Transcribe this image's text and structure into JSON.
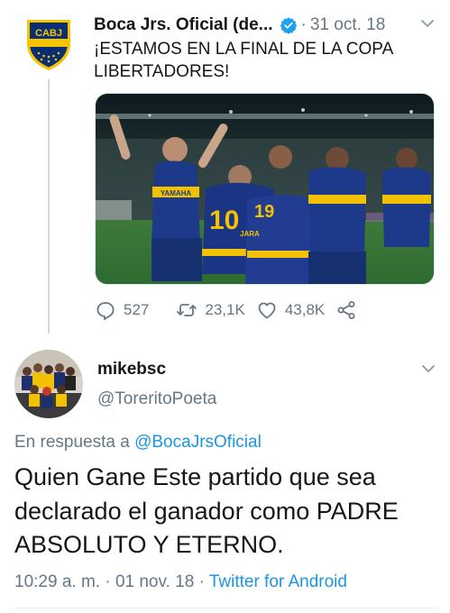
{
  "parent_tweet": {
    "display_name": "Boca Jrs. Oficial (de...",
    "date": "31 oct. 18",
    "separator": "·",
    "text": "¡ESTAMOS EN LA FINAL DE LA COPA LIBERTADORES!",
    "avatar_text": "CABJ",
    "avatar_icon": "boca-crest",
    "verified_icon": "verified-badge-icon",
    "image_text": {
      "jersey_numbers": [
        "10",
        "19"
      ],
      "sponsor": "YAMAHA",
      "sleeve": "JARA"
    },
    "actions": {
      "replies": "527",
      "retweets": "23,1K",
      "likes": "43,8K"
    }
  },
  "reply_tweet": {
    "display_name": "mikebsc",
    "handle": "@ToreritoPoeta",
    "in_reply_prefix": "En respuesta a ",
    "in_reply_to": "@BocaJrsOficial",
    "text": "Quien Gane Este partido que sea declarado el ganador como PADRE ABSOLUTO Y ETERNO.",
    "time": "10:29 a. m.",
    "date": "01 nov. 18",
    "separator": "·",
    "client": "Twitter for Android"
  },
  "colors": {
    "text": "#14171a",
    "secondary": "#657786",
    "link": "#1b95e0",
    "verified": "#1da1f2",
    "boca_blue": "#0a2e73",
    "boca_gold": "#f5c400"
  }
}
